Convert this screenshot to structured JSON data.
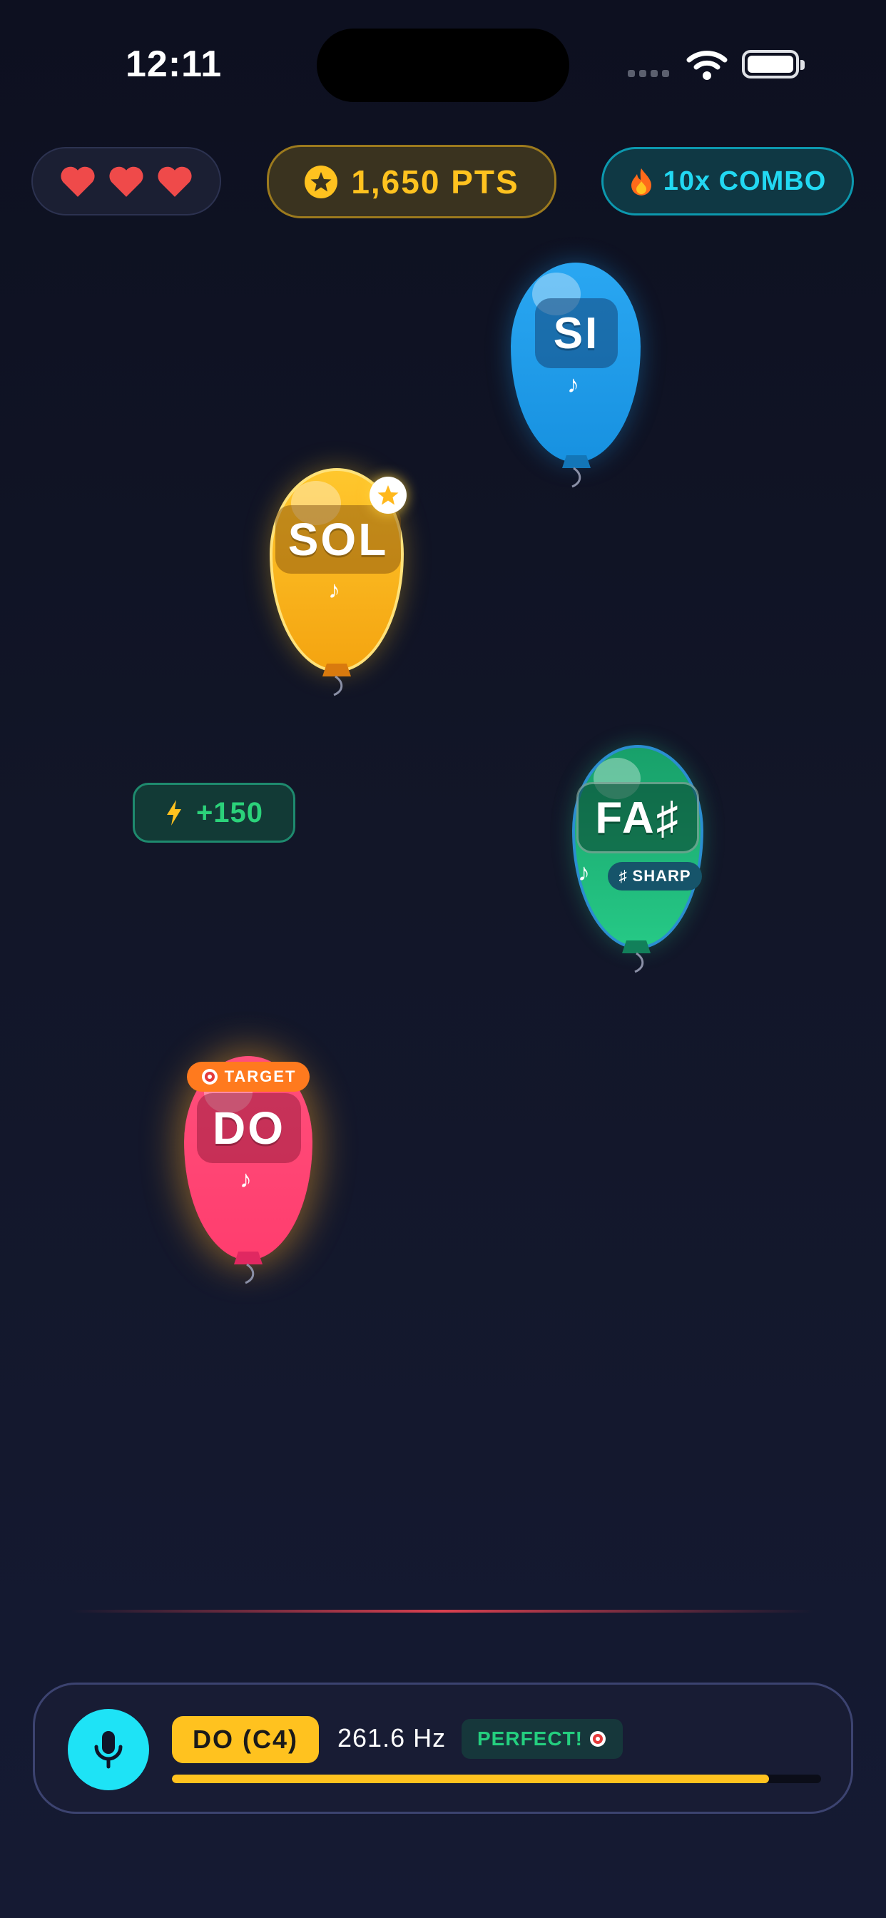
{
  "status_bar": {
    "time": "12:11"
  },
  "hud": {
    "lives": 3,
    "score": "1,650 PTS",
    "combo": "10x COMBO"
  },
  "balloons": {
    "si": {
      "note": "SI"
    },
    "sol": {
      "note": "SOL"
    },
    "fa_sharp": {
      "note": "FA♯",
      "badge": "♯ SHARP"
    },
    "do": {
      "note": "DO",
      "badge": "TARGET"
    }
  },
  "bonus": {
    "text": "+150"
  },
  "pitch_panel": {
    "detected_note": "DO (C4)",
    "frequency": "261.6 Hz",
    "feedback": "PERFECT!",
    "accuracy": 0.92
  },
  "colors": {
    "gold": "#ffc21f",
    "cyan": "#1ee3f6",
    "green": "#2bd27a",
    "pink": "#ff4f7b",
    "blue": "#1e9ff0"
  }
}
